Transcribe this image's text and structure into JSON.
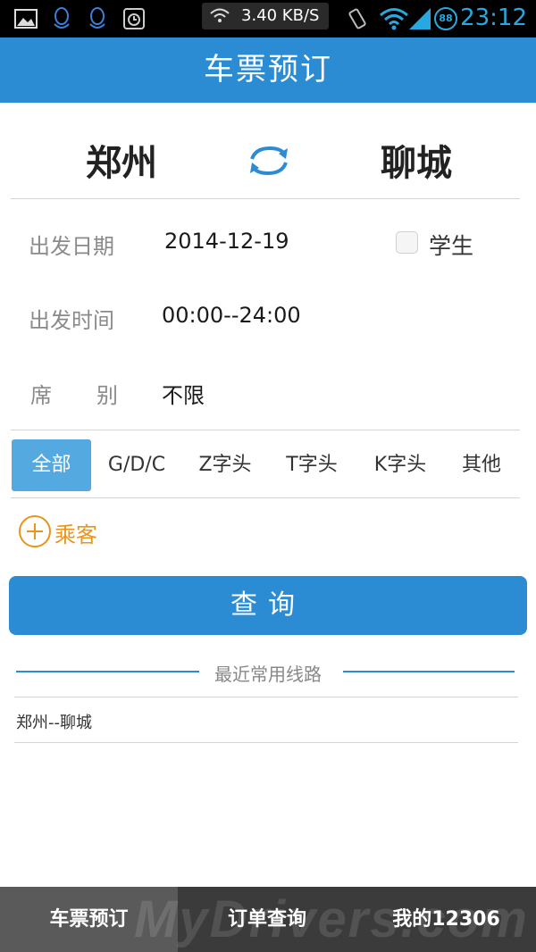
{
  "status_bar": {
    "icons": [
      "gallery-icon",
      "qq-icon",
      "qq-icon",
      "alarm-icon",
      "wifi-icon",
      "vibrate-icon",
      "wifi-signal-icon",
      "cell-signal-icon"
    ],
    "network_speed": "3.40 KB/S",
    "badge": "88",
    "time": "23:12"
  },
  "header": {
    "title": "车票预订"
  },
  "route": {
    "from": "郑州",
    "to": "聊城"
  },
  "form": {
    "date_label": "出发日期",
    "date_value": "2014-12-19",
    "student_label": "学生",
    "time_label": "出发时间",
    "time_value": "00:00--24:00",
    "seat_label_1": "席",
    "seat_label_2": "别",
    "seat_value": "不限"
  },
  "train_types": {
    "items": [
      "全部",
      "G/D/C",
      "Z字头",
      "T字头",
      "K字头",
      "其他"
    ],
    "selected": "全部"
  },
  "passenger": {
    "add_label": "乘客"
  },
  "query_button": {
    "label": "查询"
  },
  "recent": {
    "title": "最近常用线路",
    "items": [
      "郑州--聊城"
    ]
  },
  "bottom_nav": {
    "items": [
      "车票预订",
      "订单查询",
      "我的12306"
    ],
    "active": "车票预订"
  },
  "watermark": "MyDrivers.com",
  "colors": {
    "primary": "#2b8bd3",
    "tab_active": "#55a9e1",
    "accent_orange": "#e9941a",
    "status_time": "#28a8e0",
    "nav_bg": "#3b3b3b"
  }
}
